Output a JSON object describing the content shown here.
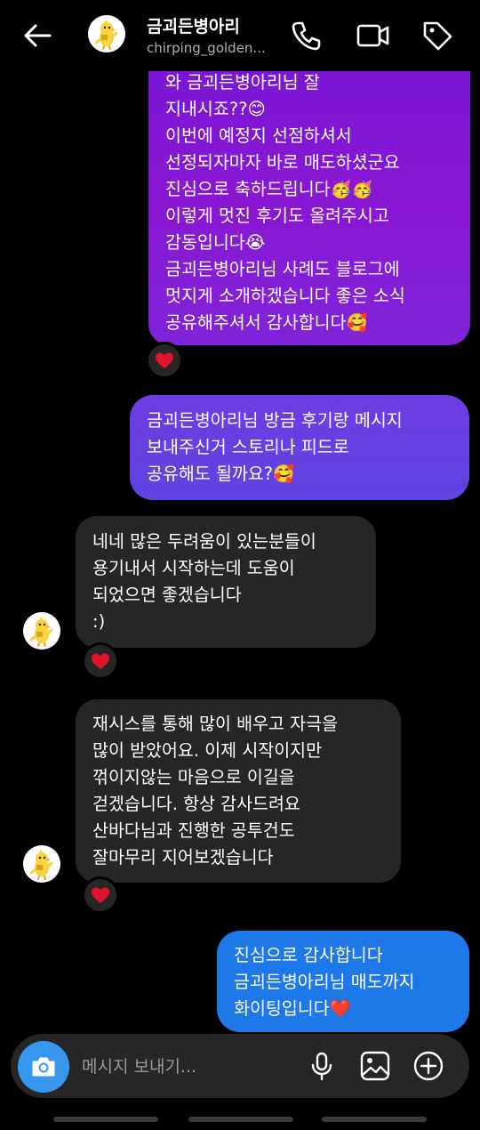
{
  "header": {
    "title": "금괴든병아리",
    "subtitle": "chirping_golden...",
    "icons": [
      "back-arrow-icon",
      "phone-icon",
      "video-icon",
      "tag-icon"
    ]
  },
  "messages": [
    {
      "direction": "outgoing",
      "text": "와 금괴든병아리님 잘\n지내시죠??😊\n이번에 예정지 선점하셔서\n선정되자마자 바로 매도하셨군요\n진심으로 축하드립니다🥳🥳\n이렇게 멋진 후기도 올려주시고\n감동입니다😭\n금괴든병아리님 사례도 블로그에\n멋지게 소개하겠습니다 좋은 소식\n공유해주셔서 감사합니다🥰",
      "reaction": "❤️"
    },
    {
      "direction": "outgoing",
      "text": "금괴든병아리님 방금 후기랑 메시지\n보내주신거 스토리나 피드로\n공유해도 될까요?🥰"
    },
    {
      "direction": "incoming",
      "text": "네네 많은 두려움이 있는분들이\n용기내서 시작하는데 도움이\n되었으면 좋겠습니다\n:)",
      "reaction": "❤️"
    },
    {
      "direction": "incoming",
      "text": "재시스를 통해 많이 배우고 자극을\n많이 받았어요. 이제 시작이지만\n꺾이지않는 마음으로 이길을\n걷겠습니다. 항상 감사드려요\n산바다님과 진행한 공투건도\n잘마무리 지어보겠습니다",
      "reaction": "❤️"
    },
    {
      "direction": "outgoing",
      "text": "진심으로 감사합니다\n금괴든병아리님 매도까지\n화이팅입니다❤️"
    }
  ],
  "composer": {
    "placeholder": "메시지 보내기...",
    "icons": [
      "camera-icon",
      "microphone-icon",
      "image-icon",
      "plus-circle-icon"
    ]
  },
  "colors": {
    "background": "#000000",
    "incoming_bubble": "#262626",
    "outgoing_purple": "#8a17d3",
    "outgoing_indigo": "#6d3ce2",
    "outgoing_blue": "#1f78e8",
    "camera_button": "#3797f0",
    "reaction_heart": "#e0142c"
  }
}
